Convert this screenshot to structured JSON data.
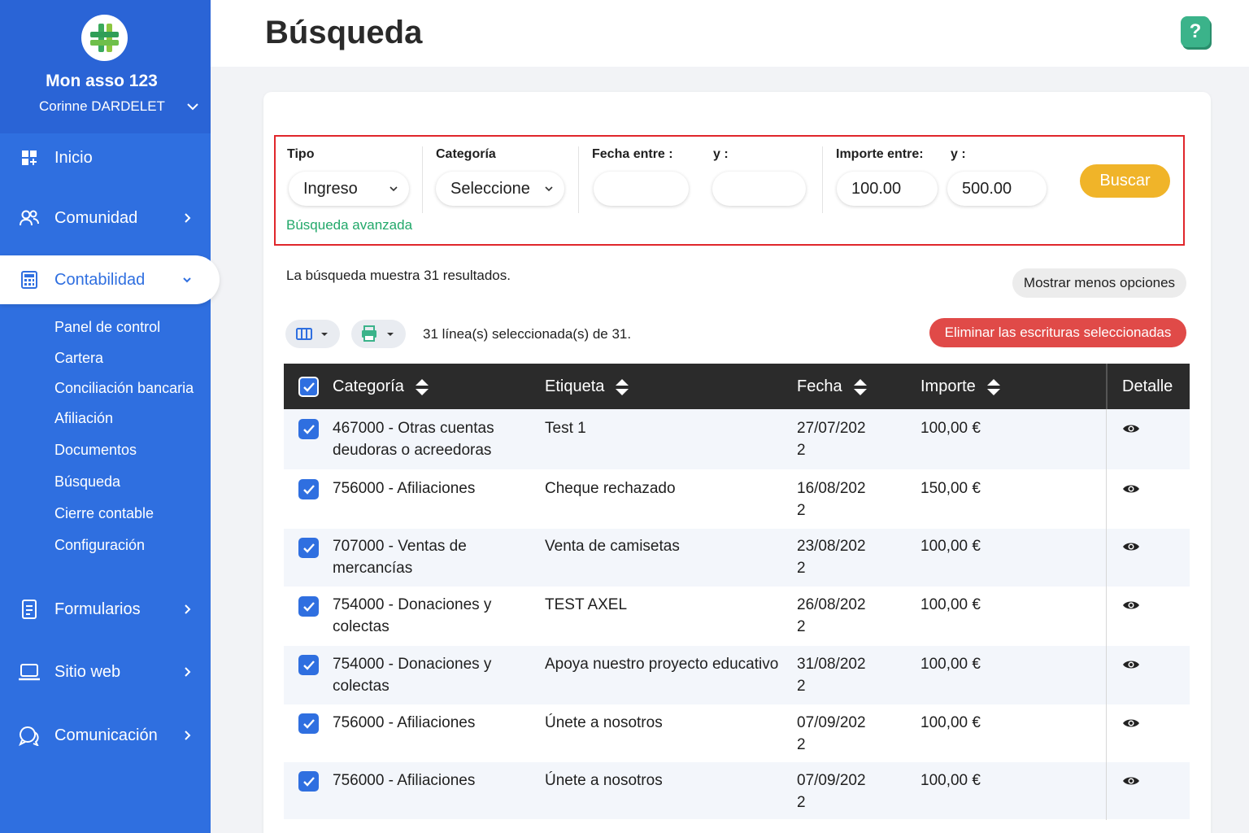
{
  "sidebar": {
    "org_name": "Mon asso 123",
    "user_name": "Corinne DARDELET",
    "nav": [
      {
        "label": "Inicio",
        "icon": "dashboard-icon"
      },
      {
        "label": "Comunidad",
        "icon": "users-icon"
      },
      {
        "label": "Contabilidad",
        "icon": "calculator-icon",
        "active": true
      },
      {
        "label": "Formularios",
        "icon": "form-icon"
      },
      {
        "label": "Sitio web",
        "icon": "laptop-icon"
      },
      {
        "label": "Comunicación",
        "icon": "chat-icon"
      }
    ],
    "submenu": [
      "Panel de control",
      "Cartera",
      "Conciliación bancaria",
      "Afiliación",
      "Documentos",
      "Búsqueda",
      "Cierre contable",
      "Configuración"
    ]
  },
  "header": {
    "title": "Búsqueda",
    "help": "?"
  },
  "filters": {
    "tipo_label": "Tipo",
    "tipo_value": "Ingreso",
    "categoria_label": "Categoría",
    "categoria_value": "Seleccione",
    "fecha_label": "Fecha entre :",
    "fecha_y_label": "y :",
    "fecha_from": "",
    "fecha_to": "",
    "importe_label": "Importe entre:",
    "importe_y_label": "y :",
    "importe_from": "100.00",
    "importe_to": "500.00",
    "buscar": "Buscar",
    "advanced_link": "Búsqueda avanzada"
  },
  "results": {
    "summary": "La búsqueda muestra 31 resultados.",
    "less_options": "Mostrar menos opciones",
    "selected": "31 línea(s) seleccionada(s) de 31.",
    "delete": "Eliminar las escrituras seleccionadas"
  },
  "table": {
    "columns": [
      "Categoría",
      "Etiqueta",
      "Fecha",
      "Importe",
      "Detalle"
    ],
    "rows": [
      {
        "categoria": "467000 - Otras cuentas deudoras o acreedoras",
        "etiqueta": "Test 1",
        "fecha": "27/07/2022",
        "importe": "100,00 €"
      },
      {
        "categoria": "756000 - Afiliaciones",
        "etiqueta": "Cheque rechazado",
        "fecha": "16/08/2022",
        "importe": "150,00 €"
      },
      {
        "categoria": "707000 - Ventas de mercancías",
        "etiqueta": "Venta de camisetas",
        "fecha": "23/08/2022",
        "importe": "100,00 €"
      },
      {
        "categoria": "754000 - Donaciones y colectas",
        "etiqueta": "TEST AXEL",
        "fecha": "26/08/2022",
        "importe": "100,00 €"
      },
      {
        "categoria": "754000 - Donaciones y colectas",
        "etiqueta": "Apoya nuestro proyecto educativo",
        "fecha": "31/08/2022",
        "importe": "100,00 €"
      },
      {
        "categoria": "756000 - Afiliaciones",
        "etiqueta": "Únete a nosotros",
        "fecha": "07/09/2022",
        "importe": "100,00 €"
      },
      {
        "categoria": "756000 - Afiliaciones",
        "etiqueta": "Únete a nosotros",
        "fecha": "07/09/2022",
        "importe": "100,00 €"
      }
    ]
  },
  "colors": {
    "sidebar": "#2f6fe0",
    "accent_green": "#22a86a",
    "buscar": "#f0b429",
    "delete": "#e04a48",
    "highlight_border": "#e0262b"
  }
}
